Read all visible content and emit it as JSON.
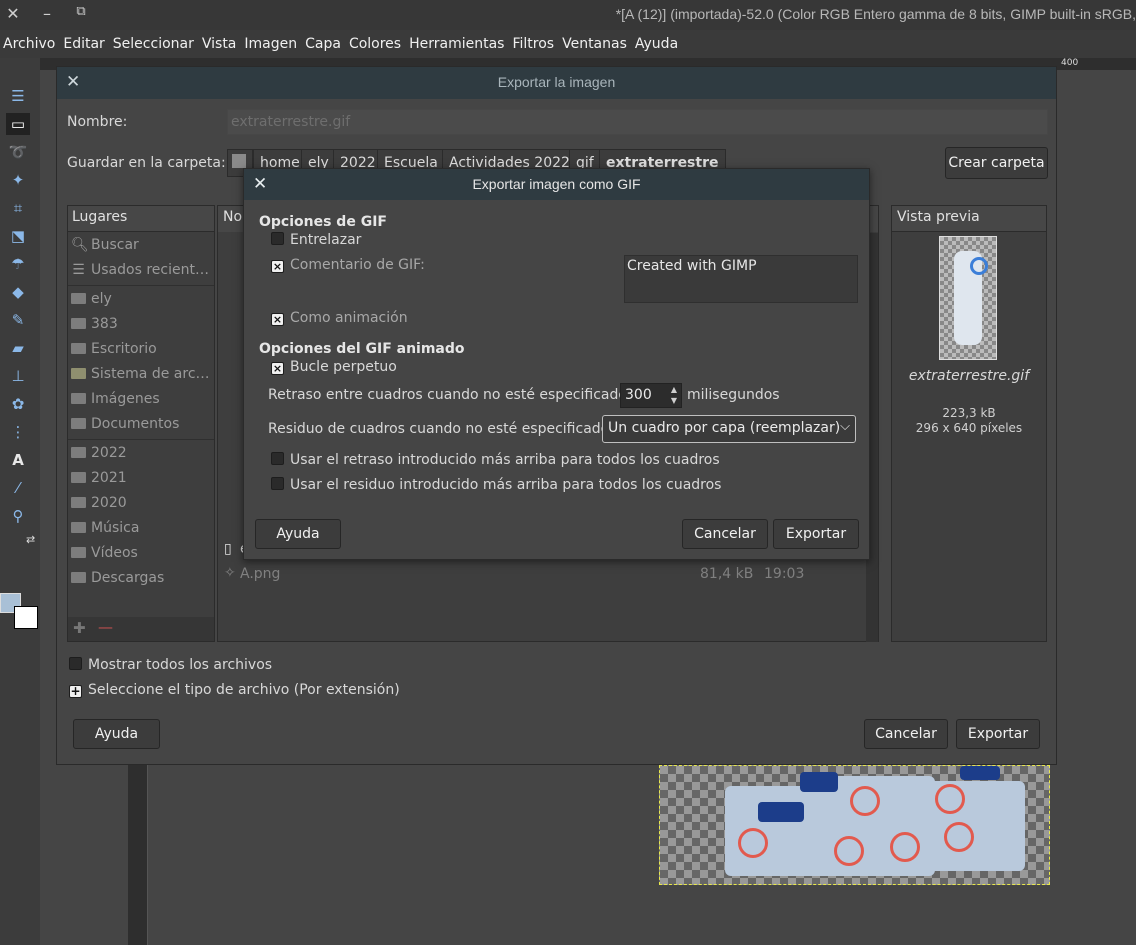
{
  "window": {
    "title": "*[A (12)] (importada)-52.0 (Color RGB Entero gamma de 8 bits, GIMP built-in sRGB,"
  },
  "menubar": [
    "Archivo",
    "Editar",
    "Seleccionar",
    "Vista",
    "Imagen",
    "Capa",
    "Colores",
    "Herramientas",
    "Filtros",
    "Ventanas",
    "Ayuda"
  ],
  "ruler": {
    "top_label": "400"
  },
  "export_dialog": {
    "title": "Exportar la imagen",
    "name_label": "Nombre:",
    "name_value": "extraterrestre.gif",
    "folder_label": "Guardar en la carpeta:",
    "breadcrumbs": [
      "home",
      "ely",
      "2022",
      "Escuela",
      "Actividades 2022",
      "gif",
      "extraterrestre"
    ],
    "create_folder": "Crear carpeta",
    "places_header": "Lugares",
    "places": [
      {
        "label": "Buscar",
        "icon": "search-icon"
      },
      {
        "label": "Usados recient…",
        "icon": "recent-icon"
      },
      {
        "label": "ely",
        "icon": "folder-icon"
      },
      {
        "label": "383",
        "icon": "folder-icon"
      },
      {
        "label": "Escritorio",
        "icon": "folder-icon"
      },
      {
        "label": "Sistema de arc…",
        "icon": "drive-icon"
      },
      {
        "label": "Imágenes",
        "icon": "folder-icon"
      },
      {
        "label": "Documentos",
        "icon": "folder-icon"
      },
      {
        "label": "2022",
        "icon": "folder-icon"
      },
      {
        "label": "2021",
        "icon": "folder-icon"
      },
      {
        "label": "2020",
        "icon": "folder-icon"
      },
      {
        "label": "Música",
        "icon": "folder-icon"
      },
      {
        "label": "Vídeos",
        "icon": "folder-icon"
      },
      {
        "label": "Descargas",
        "icon": "folder-icon"
      }
    ],
    "files_header": "No",
    "file_row": {
      "name": "A.png",
      "size": "81,4 kB",
      "time": "19:03"
    },
    "partial_row_initial": "e",
    "preview_header": "Vista previa",
    "preview_filename": "extraterrestre.gif",
    "preview_size": "223,3 kB",
    "preview_dims": "296 x 640 píxeles",
    "show_all_files": "Mostrar todos los archivos",
    "select_file_type": "Seleccione el tipo de archivo (Por extensión)",
    "help": "Ayuda",
    "cancel": "Cancelar",
    "export": "Exportar"
  },
  "gif_dialog": {
    "title": "Exportar imagen como GIF",
    "gif_options": "Opciones de GIF",
    "interlace": "Entrelazar",
    "comment_label": "Comentario de GIF:",
    "comment_value": "Created with GIMP",
    "as_animation": "Como animación",
    "anim_options": "Opciones del GIF animado",
    "loop_forever": "Bucle perpetuo",
    "delay_label": "Retraso entre cuadros cuando no esté especificado:",
    "delay_value": "300",
    "delay_unit": "milisegundos",
    "dispose_label": "Residuo de cuadros cuando no esté especificado:",
    "dispose_value": "Un cuadro por capa (reemplazar)",
    "use_delay_all": "Usar el retraso introducido más arriba para todos los cuadros",
    "use_dispose_all": "Usar el residuo introducido más arriba para todos los cuadros",
    "help": "Ayuda",
    "cancel": "Cancelar",
    "export": "Exportar"
  },
  "colors": {
    "accent_header": "#2f3b41",
    "foreground": "#a9c0d6",
    "background": "#ffffff"
  }
}
